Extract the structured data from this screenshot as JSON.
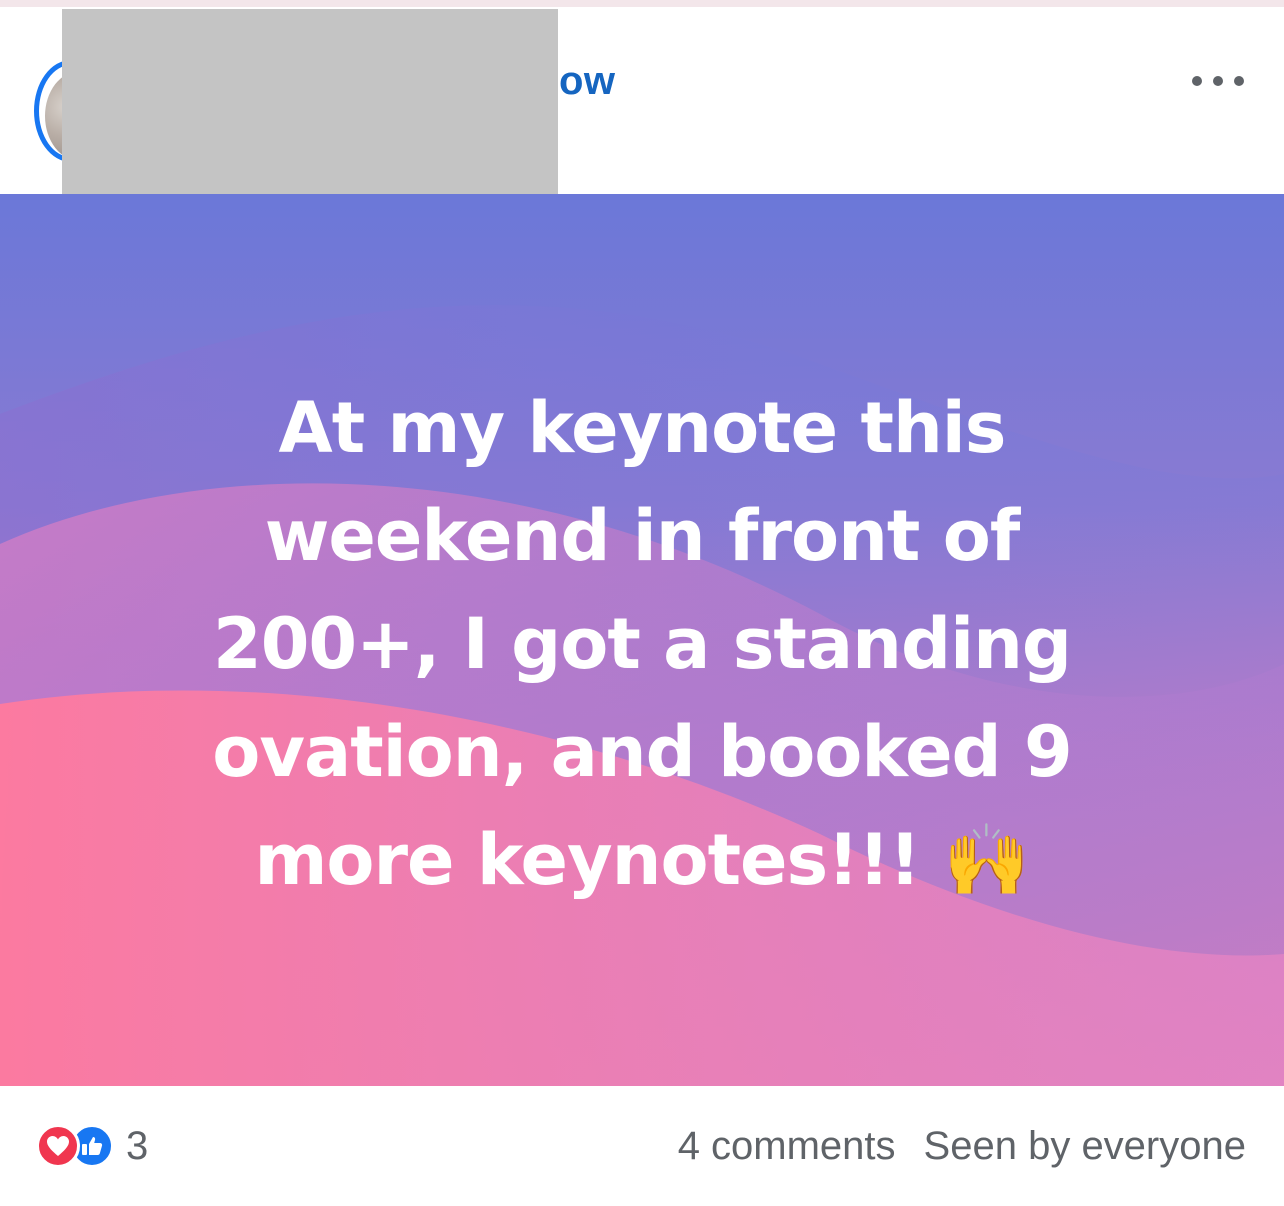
{
  "header": {
    "author_name_visible": "ow",
    "more_label": "•••"
  },
  "post": {
    "lines": [
      "At my keynote this",
      "weekend in front of",
      "200+, I got a standing",
      "ovation, and booked 9",
      "more keynotes!!! 🙌"
    ],
    "background_colors": [
      "#6b78d8",
      "#c27bc6",
      "#f07fb0"
    ]
  },
  "footer": {
    "reaction_count": "3",
    "comments": "4 comments",
    "seen_by": "Seen by everyone",
    "reaction_icons": [
      "heart-icon",
      "like-icon"
    ]
  }
}
